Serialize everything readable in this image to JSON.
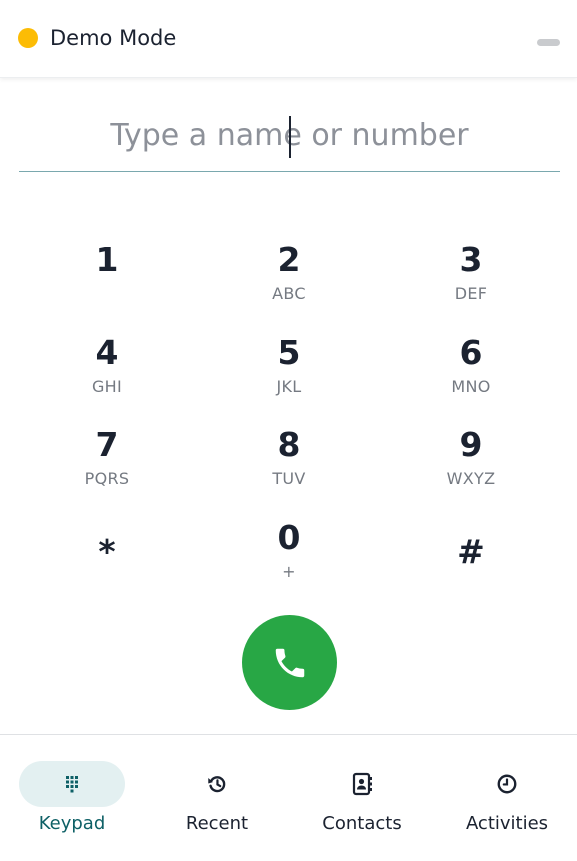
{
  "header": {
    "title": "Demo Mode",
    "status_color": "#fcbc05",
    "status_icon": "status-dot-icon"
  },
  "dialer": {
    "value": "",
    "placeholder": "Type a name or number"
  },
  "keypad": [
    {
      "digit": "1",
      "letters": ""
    },
    {
      "digit": "2",
      "letters": "ABC"
    },
    {
      "digit": "3",
      "letters": "DEF"
    },
    {
      "digit": "4",
      "letters": "GHI"
    },
    {
      "digit": "5",
      "letters": "JKL"
    },
    {
      "digit": "6",
      "letters": "MNO"
    },
    {
      "digit": "7",
      "letters": "PQRS"
    },
    {
      "digit": "8",
      "letters": "TUV"
    },
    {
      "digit": "9",
      "letters": "WXYZ"
    },
    {
      "digit": "*",
      "letters": ""
    },
    {
      "digit": "0",
      "letters": "+"
    },
    {
      "digit": "#",
      "letters": ""
    }
  ],
  "call": {
    "icon": "phone-icon",
    "color": "#28a745"
  },
  "tabs": [
    {
      "label": "Keypad",
      "icon": "keypad-icon",
      "active": true
    },
    {
      "label": "Recent",
      "icon": "history-icon",
      "active": false
    },
    {
      "label": "Contacts",
      "icon": "address-book-icon",
      "active": false
    },
    {
      "label": "Activities",
      "icon": "clock-icon",
      "active": false
    }
  ],
  "colors": {
    "accent": "#0e6066",
    "active_tab_bg": "#e3f0f1"
  }
}
